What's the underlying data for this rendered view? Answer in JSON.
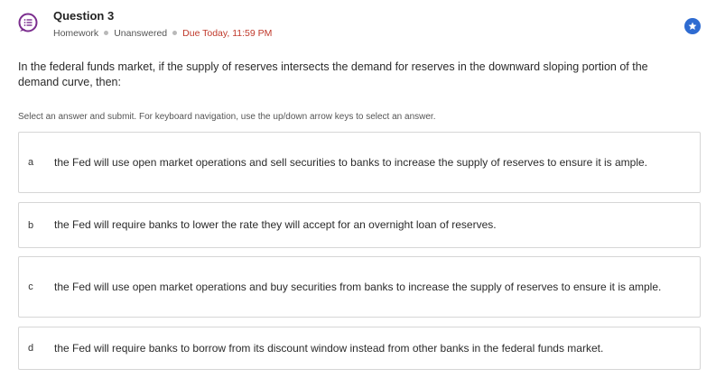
{
  "question": {
    "title": "Question 3",
    "type": "Homework",
    "status": "Unanswered",
    "due": "Due Today, 11:59 PM",
    "text": "In the federal funds market, if the supply of reserves intersects the demand for reserves in the downward sloping portion of the demand curve, then:",
    "instructions": "Select an answer and submit. For keyboard navigation, use the up/down arrow keys to select an answer."
  },
  "answers": [
    {
      "letter": "a",
      "text": "the Fed will use open market operations and sell securities to banks to increase the supply of reserves to ensure it is ample."
    },
    {
      "letter": "b",
      "text": "the Fed will require banks to lower the rate they will accept for an overnight loan of reserves."
    },
    {
      "letter": "c",
      "text": "the Fed will use open market operations and buy securities from banks to increase the supply of reserves to ensure it is ample."
    },
    {
      "letter": "d",
      "text": "the Fed will require banks to borrow from its discount window instead from other banks in the federal funds market."
    }
  ],
  "icons": {
    "question_icon": "question-list-icon",
    "bookmark_icon": "star-bookmark-icon"
  },
  "colors": {
    "accent_purple": "#7b2d8e",
    "bookmark_blue": "#2e6bd1",
    "due_red": "#c0392b"
  }
}
